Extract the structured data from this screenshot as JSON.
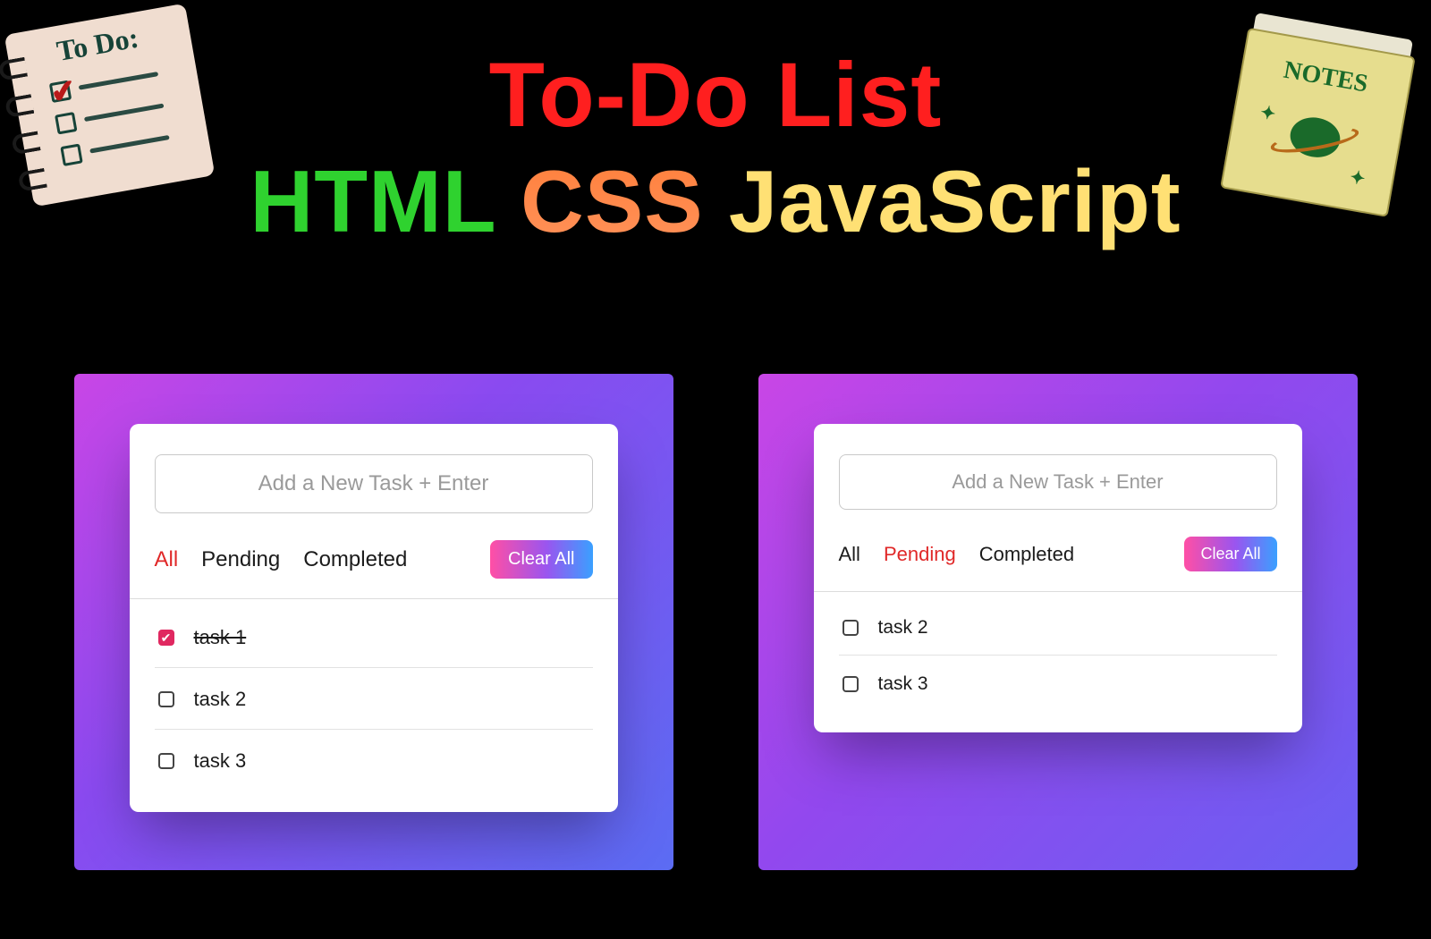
{
  "header": {
    "title": "To-Do List",
    "tech": {
      "html": "HTML",
      "css": "CSS",
      "js": "JavaScript"
    }
  },
  "illus": {
    "todo_heading": "To Do:",
    "notes_heading": "NOTES"
  },
  "apps": {
    "left": {
      "input_placeholder": "Add a New Task + Enter",
      "filters": {
        "all": "All",
        "pending": "Pending",
        "completed": "Completed"
      },
      "active_filter": "all",
      "clear_label": "Clear All",
      "tasks": [
        {
          "text": "task 1",
          "completed": true
        },
        {
          "text": "task 2",
          "completed": false
        },
        {
          "text": "task 3",
          "completed": false
        }
      ]
    },
    "right": {
      "input_placeholder": "Add a New Task + Enter",
      "filters": {
        "all": "All",
        "pending": "Pending",
        "completed": "Completed"
      },
      "active_filter": "pending",
      "clear_label": "Clear All",
      "tasks": [
        {
          "text": "task 2",
          "completed": false
        },
        {
          "text": "task 3",
          "completed": false
        }
      ]
    }
  }
}
